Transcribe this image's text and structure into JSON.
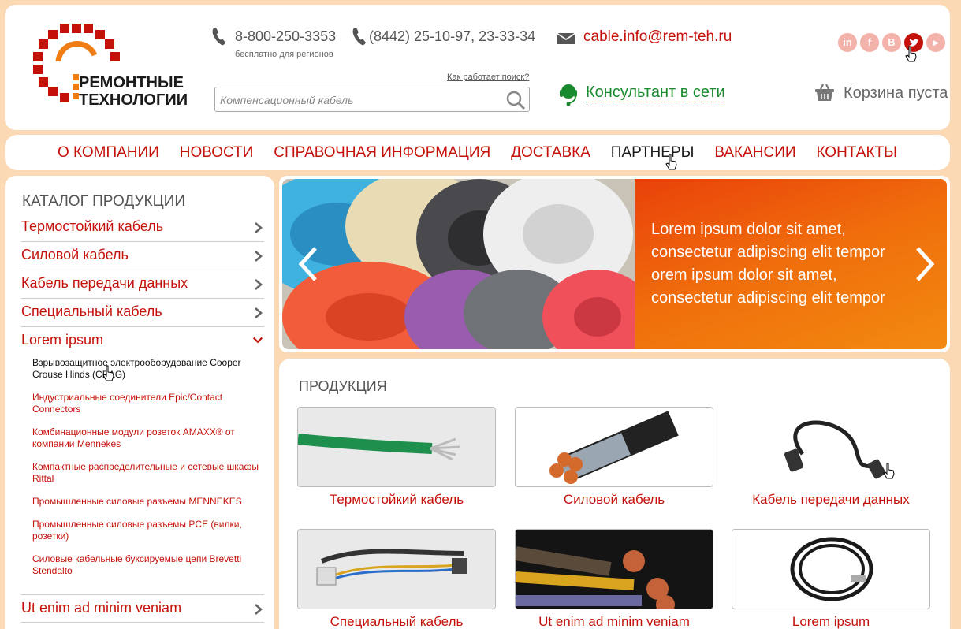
{
  "header": {
    "logo": {
      "line1": "РЕМОНТНЫЕ",
      "line2": "ТЕХНОЛОГИИ"
    },
    "phone1": {
      "number": "8-800-250-3353",
      "caption": "бесплатно для регионов"
    },
    "phone2": {
      "number": "(8442) 25-10-97, 23-33-34"
    },
    "email": "cable.info@rem-teh.ru",
    "social": [
      {
        "label": "in",
        "icon": "linkedin-icon"
      },
      {
        "label": "f",
        "icon": "facebook-icon"
      },
      {
        "label": "B",
        "icon": "vkontakte-icon"
      },
      {
        "label": "t",
        "icon": "twitter-icon",
        "active": true
      },
      {
        "label": "▶",
        "icon": "youtube-icon"
      }
    ],
    "search_hint": "Как работает поиск?",
    "search_placeholder": "Компенсационный кабель",
    "consultant": "Консультант в сети",
    "cart": "Корзина пуста"
  },
  "nav": {
    "items": [
      "О КОМПАНИИ",
      "НОВОСТИ",
      "СПРАВОЧНАЯ ИНФОРМАЦИЯ",
      "ДОСТАВКА",
      "ПАРТНЕРЫ",
      "ВАКАНСИИ",
      "КОНТАКТЫ"
    ],
    "active": "ПАРТНЕРЫ"
  },
  "sidebar": {
    "title": "КАТАЛОГ ПРОДУКЦИИ",
    "items": [
      {
        "label": "Термостойкий кабель"
      },
      {
        "label": "Силовой кабель"
      },
      {
        "label": "Кабель передачи данных"
      },
      {
        "label": "Специальный кабель"
      },
      {
        "label": "Lorem ipsum",
        "open": true
      }
    ],
    "subitems": [
      "Взрывозащитное электрооборудование Cooper Crouse Hinds (CEAG)",
      "Индустриальные соединители Epic/Contact Connectors",
      "Комбинационные модули розеток AMAXX® от компании Mennekes",
      "Компактные распределительные и сетевые шкафы Rittal",
      "Промышленные силовые разъемы MENNEKES",
      "Промышленные силовые разъемы PCE (вилки, розетки)",
      "Силовые кабельные буксируемые цепи Brevetti Stendalto"
    ],
    "last_item": "Ut enim ad minim veniam"
  },
  "slider": {
    "text": "Lorem ipsum dolor sit amet, consectetur adipiscing elit tempor orem ipsum dolor sit amet, consectetur adipiscing elit tempor"
  },
  "products": {
    "title": "ПРОДУКЦИЯ",
    "items": [
      {
        "name": "Термостойкий кабель"
      },
      {
        "name": "Силовой кабель"
      },
      {
        "name": "Кабель передачи данных"
      },
      {
        "name": "Специальный кабель"
      },
      {
        "name": "Ut enim ad minim veniam"
      },
      {
        "name": "Lorem ipsum"
      }
    ]
  },
  "colors": {
    "accent": "#c4120b",
    "page_bg": "#fbd9b4",
    "online": "#1a8a2e",
    "slide_orange": "#f06f0c"
  }
}
